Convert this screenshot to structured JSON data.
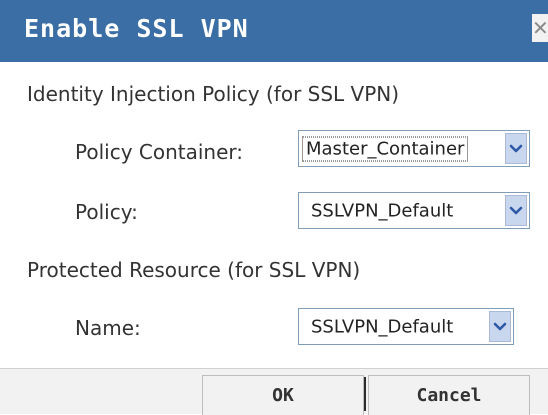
{
  "dialog": {
    "title": "Enable SSL VPN",
    "close_glyph": "✕",
    "close_icon": "close-icon"
  },
  "identity_injection": {
    "heading": "Identity Injection Policy (for SSL VPN)",
    "policy_container": {
      "label": "Policy Container:",
      "value": "Master_Container"
    },
    "policy": {
      "label": "Policy:",
      "value": "SSLVPN_Default"
    }
  },
  "protected_resource": {
    "heading": "Protected Resource (for SSL VPN)",
    "name": {
      "label": "Name:",
      "value": "SSLVPN_Default"
    }
  },
  "buttons": {
    "ok": "OK",
    "cancel": "Cancel"
  },
  "colors": {
    "title_bar": "#3a6ea5",
    "dropdown_arrow_bg": "#c8d6ee",
    "arrow_glyph": "#2d5aa8"
  }
}
